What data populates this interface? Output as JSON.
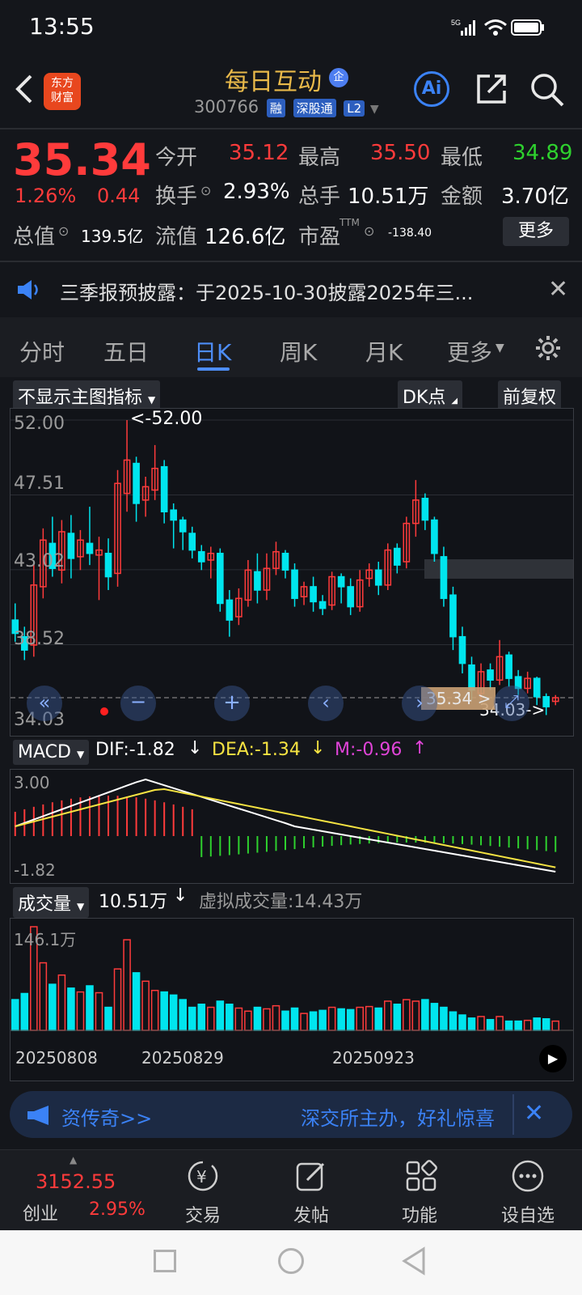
{
  "status_bar": {
    "time": "13:55"
  },
  "header": {
    "logo_line1": "东方",
    "logo_line2": "财富",
    "stock_name": "每日互动",
    "stock_badge": "企",
    "stock_code": "300766",
    "tag_rong": "融",
    "tag_hk": "深股通",
    "tag_l2": "L2",
    "ai_label": "Ai"
  },
  "quote": {
    "price": "35.34",
    "change_pct": "1.26%",
    "change_amt": "0.44",
    "open_label": "今开",
    "open": "35.12",
    "high_label": "最高",
    "high": "35.50",
    "low_label": "最低",
    "low": "34.89",
    "turnover_label": "换手",
    "turnover": "2.93%",
    "volume_label": "总手",
    "volume": "10.51万",
    "amount_label": "金额",
    "amount": "3.70亿",
    "mktcap_label": "总值",
    "mktcap": "139.5亿",
    "float_label": "流值",
    "float": "126.6亿",
    "pe_label": "市盈",
    "pe_sup": "TTM",
    "pe": "-138.40",
    "more_button": "更多"
  },
  "notice": {
    "text": "三季报预披露：于2025-10-30披露2025年三..."
  },
  "tabs": [
    "分时",
    "五日",
    "日K",
    "周K",
    "月K",
    "更多"
  ],
  "active_tab": "日K",
  "chart_controls": {
    "indicator_select": "不显示主图指标",
    "dk_button": "DK点",
    "adjust_button": "前复权"
  },
  "chart_data": [
    {
      "type": "candlestick",
      "y_ticks": [
        "52.00",
        "47.51",
        "43.02",
        "38.52",
        "34.03"
      ],
      "ylim": [
        34.03,
        52.0
      ],
      "max_annotation": "<-52.00",
      "min_annotation": "34.03->",
      "current_price_tag": "35.34 >",
      "candles": [
        [
          40.0,
          39.2,
          41.0,
          38.7
        ],
        [
          39.0,
          38.2,
          39.6,
          37.6
        ],
        [
          38.5,
          42.1,
          43.5,
          37.8
        ],
        [
          42.0,
          44.8,
          45.5,
          41.3
        ],
        [
          44.6,
          43.1,
          46.2,
          42.6
        ],
        [
          43.0,
          45.3,
          46.0,
          42.2
        ],
        [
          45.2,
          43.7,
          46.3,
          42.5
        ],
        [
          43.8,
          44.8,
          45.4,
          43.0
        ],
        [
          44.6,
          44.0,
          46.8,
          43.3
        ],
        [
          43.9,
          44.2,
          45.0,
          41.2
        ],
        [
          44.0,
          42.6,
          44.9,
          41.8
        ],
        [
          42.8,
          48.2,
          49.0,
          42.0
        ],
        [
          47.6,
          49.6,
          52.0,
          46.5
        ],
        [
          49.4,
          47.0,
          49.8,
          45.9
        ],
        [
          47.2,
          48.0,
          48.6,
          46.2
        ],
        [
          47.8,
          49.1,
          50.5,
          47.2
        ],
        [
          49.2,
          46.5,
          49.6,
          45.8
        ],
        [
          46.6,
          46.0,
          47.0,
          44.3
        ],
        [
          46.0,
          45.3,
          46.2,
          44.2
        ],
        [
          45.2,
          44.2,
          45.6,
          43.7
        ],
        [
          44.1,
          43.5,
          44.5,
          43.0
        ],
        [
          43.6,
          44.0,
          44.4,
          42.5
        ],
        [
          44.0,
          41.0,
          44.3,
          40.5
        ],
        [
          41.2,
          40.0,
          41.8,
          39.0
        ],
        [
          40.2,
          41.3,
          41.9,
          39.7
        ],
        [
          41.2,
          43.0,
          43.6,
          40.8
        ],
        [
          42.9,
          41.8,
          44.0,
          41.0
        ],
        [
          41.8,
          43.1,
          44.0,
          41.2
        ],
        [
          43.1,
          44.1,
          44.7,
          42.7
        ],
        [
          44.0,
          43.0,
          44.2,
          42.5
        ],
        [
          43.0,
          41.3,
          43.4,
          40.8
        ],
        [
          41.4,
          42.0,
          42.3,
          40.9
        ],
        [
          42.0,
          41.1,
          42.6,
          40.5
        ],
        [
          41.1,
          40.7,
          41.5,
          40.3
        ],
        [
          40.9,
          42.6,
          42.9,
          40.6
        ],
        [
          42.6,
          42.0,
          42.8,
          41.0
        ],
        [
          42.0,
          40.8,
          42.5,
          40.3
        ],
        [
          40.8,
          42.4,
          43.0,
          40.5
        ],
        [
          42.5,
          43.0,
          43.4,
          42.0
        ],
        [
          43.0,
          42.1,
          43.5,
          41.5
        ],
        [
          42.1,
          44.2,
          44.6,
          41.8
        ],
        [
          44.3,
          43.3,
          44.6,
          42.8
        ],
        [
          43.5,
          45.8,
          46.2,
          43.1
        ],
        [
          45.8,
          47.2,
          48.4,
          45.0
        ],
        [
          47.3,
          46.0,
          47.6,
          45.4
        ],
        [
          46.0,
          44.0,
          46.2,
          43.5
        ],
        [
          43.8,
          41.3,
          44.4,
          40.8
        ],
        [
          41.5,
          39.0,
          42.0,
          38.2
        ],
        [
          39.0,
          37.4,
          39.6,
          36.8
        ],
        [
          37.3,
          35.8,
          37.8,
          35.2
        ],
        [
          35.6,
          36.9,
          37.4,
          35.2
        ],
        [
          37.0,
          36.4,
          37.4,
          35.8
        ],
        [
          36.4,
          37.8,
          38.8,
          36.1
        ],
        [
          37.9,
          36.5,
          38.1,
          36.0
        ],
        [
          36.6,
          35.9,
          37.0,
          35.5
        ],
        [
          35.9,
          36.5,
          36.9,
          35.6
        ],
        [
          36.5,
          35.4,
          36.6,
          34.9
        ],
        [
          35.4,
          34.8,
          35.6,
          34.3
        ],
        [
          35.12,
          35.34,
          35.5,
          34.89
        ]
      ]
    },
    {
      "type": "macd",
      "indicator_select": "MACD",
      "dif_label": "DIF:-1.82",
      "dea_label": "DEA:-1.34",
      "m_label": "M:-0.96",
      "y_ticks": [
        "3.00",
        "-1.82"
      ]
    },
    {
      "type": "bar",
      "indicator_select": "成交量",
      "volume_label": "10.51万",
      "virtual_label": "虚拟成交量:14.43万",
      "y_ticks": [
        "146.1万"
      ],
      "x_ticks": [
        "20250808",
        "20250829",
        "20250923"
      ]
    }
  ],
  "ad": {
    "left": "资传奇>>",
    "right": "深交所主办，好礼惊喜"
  },
  "bottom_nav": {
    "index_value": "3152.55",
    "index_name": "创业",
    "index_change": "2.95%",
    "items": [
      "交易",
      "发帖",
      "功能",
      "设自选"
    ]
  }
}
